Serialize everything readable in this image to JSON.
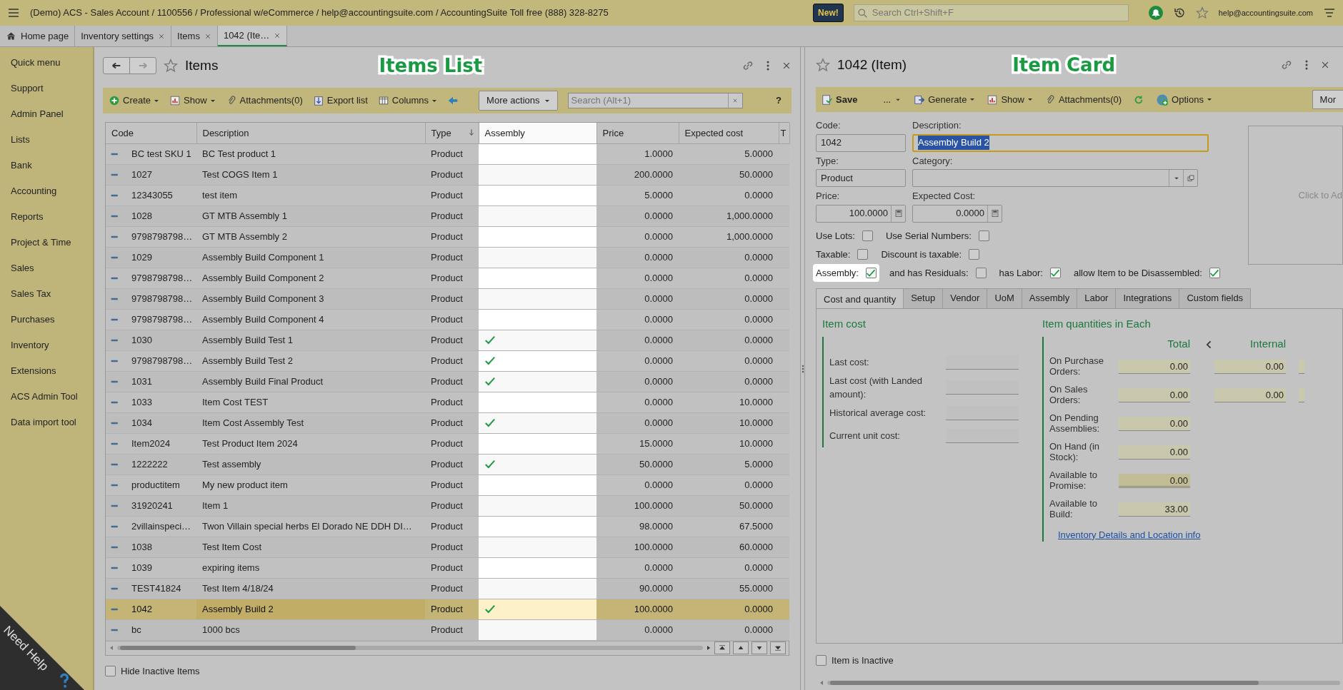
{
  "app_bar": {
    "title": "(Demo) ACS - Sales Account / 1100556 / Professional w/eCommerce / help@accountingsuite.com / AccountingSuite Toll free (888) 328-8275",
    "new_badge": "New!",
    "search": {
      "placeholder": "Search Ctrl+Shift+F"
    },
    "user": "help@accountingsuite.com"
  },
  "tabs": [
    {
      "label": "Home page",
      "closable": false,
      "selected": false
    },
    {
      "label": "Inventory settings",
      "closable": true,
      "selected": false
    },
    {
      "label": "Items",
      "closable": true,
      "selected": false
    },
    {
      "label": "1042 (Ite…",
      "closable": true,
      "selected": true
    }
  ],
  "sidebar": {
    "items": [
      "Quick menu",
      "Support",
      "Admin Panel",
      "Lists",
      "Bank",
      "Accounting",
      "Reports",
      "Project & Time",
      "Sales",
      "Sales Tax",
      "Purchases",
      "Inventory",
      "Extensions",
      "ACS Admin Tool",
      "Data import tool"
    ],
    "need_help": "Need Help"
  },
  "items_list": {
    "title": "Items",
    "annotation": "Items List",
    "toolbar": {
      "buttons": [
        {
          "label": "Create",
          "dropdown": true
        },
        {
          "label": "Show",
          "dropdown": true
        },
        {
          "label": "Attachments(0)",
          "dropdown": false
        },
        {
          "label": "Export list",
          "dropdown": false
        },
        {
          "label": "Columns",
          "dropdown": true
        }
      ],
      "more_actions": "More actions",
      "search": {
        "placeholder": "Search (Alt+1)"
      },
      "help": "?"
    },
    "table": {
      "columns": [
        {
          "label": "Code",
          "sorted": false,
          "highlighted": false
        },
        {
          "label": "Description",
          "sorted": false,
          "highlighted": false
        },
        {
          "label": "Type",
          "sorted": true,
          "highlighted": false
        },
        {
          "label": "Assembly",
          "sorted": false,
          "highlighted": true
        },
        {
          "label": "Price",
          "sorted": false,
          "highlighted": false
        },
        {
          "label": "Expected cost",
          "sorted": false,
          "highlighted": false
        },
        {
          "label": "T",
          "sorted": false,
          "highlighted": false
        }
      ],
      "rows": [
        {
          "code": "BC test SKU 1",
          "description": "BC Test product 1",
          "type": "Product",
          "assembly": false,
          "price": "1.0000",
          "expected_cost": "5.0000",
          "selected": false
        },
        {
          "code": "1027",
          "description": "Test COGS Item 1",
          "type": "Product",
          "assembly": false,
          "price": "200.0000",
          "expected_cost": "50.0000",
          "selected": false
        },
        {
          "code": "12343055",
          "description": "test item",
          "type": "Product",
          "assembly": false,
          "price": "5.0000",
          "expected_cost": "0.0000",
          "selected": false
        },
        {
          "code": "1028",
          "description": "GT MTB Assembly 1",
          "type": "Product",
          "assembly": false,
          "price": "0.0000",
          "expected_cost": "1,000.0000",
          "selected": false
        },
        {
          "code": "9798798798…",
          "description": "GT MTB Assembly 2",
          "type": "Product",
          "assembly": false,
          "price": "0.0000",
          "expected_cost": "1,000.0000",
          "selected": false
        },
        {
          "code": "1029",
          "description": "Assembly Build Component 1",
          "type": "Product",
          "assembly": false,
          "price": "0.0000",
          "expected_cost": "0.0000",
          "selected": false
        },
        {
          "code": "9798798798…",
          "description": "Assembly Build Component 2",
          "type": "Product",
          "assembly": false,
          "price": "0.0000",
          "expected_cost": "0.0000",
          "selected": false
        },
        {
          "code": "9798798798…",
          "description": "Assembly Build Component 3",
          "type": "Product",
          "assembly": false,
          "price": "0.0000",
          "expected_cost": "0.0000",
          "selected": false
        },
        {
          "code": "9798798798…",
          "description": "Assembly Build Component 4",
          "type": "Product",
          "assembly": false,
          "price": "0.0000",
          "expected_cost": "0.0000",
          "selected": false
        },
        {
          "code": "1030",
          "description": "Assembly Build Test 1",
          "type": "Product",
          "assembly": true,
          "price": "0.0000",
          "expected_cost": "0.0000",
          "selected": false
        },
        {
          "code": "9798798798…",
          "description": "Assembly Build Test 2",
          "type": "Product",
          "assembly": true,
          "price": "0.0000",
          "expected_cost": "0.0000",
          "selected": false
        },
        {
          "code": "1031",
          "description": "Assembly Build Final Product",
          "type": "Product",
          "assembly": true,
          "price": "0.0000",
          "expected_cost": "0.0000",
          "selected": false
        },
        {
          "code": "1033",
          "description": "Item Cost TEST",
          "type": "Product",
          "assembly": false,
          "price": "0.0000",
          "expected_cost": "10.0000",
          "selected": false
        },
        {
          "code": "1034",
          "description": "Item Cost Assembly Test",
          "type": "Product",
          "assembly": true,
          "price": "0.0000",
          "expected_cost": "10.0000",
          "selected": false
        },
        {
          "code": "Item2024",
          "description": "Test Product Item 2024",
          "type": "Product",
          "assembly": false,
          "price": "15.0000",
          "expected_cost": "10.0000",
          "selected": false
        },
        {
          "code": "1222222",
          "description": "Test assembly",
          "type": "Product",
          "assembly": true,
          "price": "50.0000",
          "expected_cost": "5.0000",
          "selected": false
        },
        {
          "code": "productitem",
          "description": "My new product item",
          "type": "Product",
          "assembly": false,
          "price": "0.0000",
          "expected_cost": "0.0000",
          "selected": false
        },
        {
          "code": "31920241",
          "description": "Item 1",
          "type": "Product",
          "assembly": false,
          "price": "100.0000",
          "expected_cost": "50.0000",
          "selected": false
        },
        {
          "code": "2villainspeci…",
          "description": "Twon Villain special herbs El Dorado NE DDH DI…",
          "type": "Product",
          "assembly": false,
          "price": "98.0000",
          "expected_cost": "67.5000",
          "selected": false
        },
        {
          "code": "1038",
          "description": "Test Item Cost",
          "type": "Product",
          "assembly": false,
          "price": "100.0000",
          "expected_cost": "60.0000",
          "selected": false
        },
        {
          "code": "1039",
          "description": "expiring items",
          "type": "Product",
          "assembly": false,
          "price": "0.0000",
          "expected_cost": "0.0000",
          "selected": false
        },
        {
          "code": "TEST41824",
          "description": "Test Item 4/18/24",
          "type": "Product",
          "assembly": false,
          "price": "90.0000",
          "expected_cost": "55.0000",
          "selected": false
        },
        {
          "code": "1042",
          "description": "Assembly Build 2",
          "type": "Product",
          "assembly": true,
          "price": "100.0000",
          "expected_cost": "0.0000",
          "selected": true
        },
        {
          "code": "bc",
          "description": "1000 bcs",
          "type": "Product",
          "assembly": false,
          "price": "0.0000",
          "expected_cost": "0.0000",
          "selected": false
        }
      ]
    },
    "hide_inactive": {
      "label": "Hide Inactive Items",
      "checked": false
    }
  },
  "item_card": {
    "title": "1042 (Item)",
    "annotation": "Item Card",
    "toolbar": {
      "save": "Save",
      "more": "...",
      "buttons": [
        {
          "label": "Generate",
          "dropdown": true
        },
        {
          "label": "Show",
          "dropdown": true
        },
        {
          "label": "Attachments(0)",
          "dropdown": false
        }
      ],
      "options": "Options",
      "cut_button": "Mor"
    },
    "code": {
      "label": "Code:",
      "value": "1042"
    },
    "description": {
      "label": "Description:",
      "value": "Assembly Build 2"
    },
    "type": {
      "label": "Type:",
      "value": "Product"
    },
    "category": {
      "label": "Category:"
    },
    "price": {
      "label": "Price:",
      "value": "100.0000"
    },
    "expected_cost": {
      "label": "Expected Cost:",
      "value": "0.0000"
    },
    "image_hint": "Click to Ad",
    "options": [
      [
        {
          "label": "Use Lots:",
          "checked": false,
          "highlighted": false
        },
        {
          "label": "Use Serial Numbers:",
          "checked": false,
          "highlighted": false
        }
      ],
      [
        {
          "label": "Taxable:",
          "checked": false,
          "highlighted": false
        },
        {
          "label": "Discount is taxable:",
          "checked": false,
          "highlighted": false
        }
      ],
      [
        {
          "label": "Assembly:",
          "checked": true,
          "highlighted": true
        },
        {
          "label": "and has Residuals:",
          "checked": false,
          "highlighted": false
        },
        {
          "label": "has Labor:",
          "checked": true,
          "highlighted": false
        },
        {
          "label": "allow Item to be Disassembled:",
          "checked": true,
          "highlighted": false
        }
      ]
    ],
    "tabs": [
      {
        "label": "Cost and quantity",
        "selected": true
      },
      {
        "label": "Setup",
        "selected": false
      },
      {
        "label": "Vendor",
        "selected": false
      },
      {
        "label": "UoM",
        "selected": false
      },
      {
        "label": "Assembly",
        "selected": false
      },
      {
        "label": "Labor",
        "selected": false
      },
      {
        "label": "Integrations",
        "selected": false
      },
      {
        "label": "Custom fields",
        "selected": false
      }
    ],
    "item_cost": {
      "title": "Item cost",
      "fields": [
        "Last cost:",
        "Last cost (with Landed amount):",
        "Historical average cost:",
        "Current unit cost:"
      ]
    },
    "quantities": {
      "title": "Item quantities in Each",
      "columns": [
        "Total",
        "Internal"
      ],
      "rows": [
        {
          "label": "On Purchase Orders:",
          "total": "0.00",
          "internal": "0.00",
          "kind": "input"
        },
        {
          "label": "On Sales Orders:",
          "total": "0.00",
          "internal": "0.00",
          "kind": "input"
        },
        {
          "label": "On Pending Assemblies:",
          "total": "0.00",
          "kind": "input"
        },
        {
          "label": "On Hand (in Stock):",
          "total": "0.00",
          "kind": "input"
        },
        {
          "label": "Available to Promise:",
          "total": "0.00",
          "kind": "computed"
        },
        {
          "label": "Available to Build:",
          "total": "33.00",
          "kind": "input"
        }
      ],
      "link": "Inventory Details and Location info"
    },
    "inactive": {
      "label": "Item is Inactive",
      "checked": false
    }
  }
}
